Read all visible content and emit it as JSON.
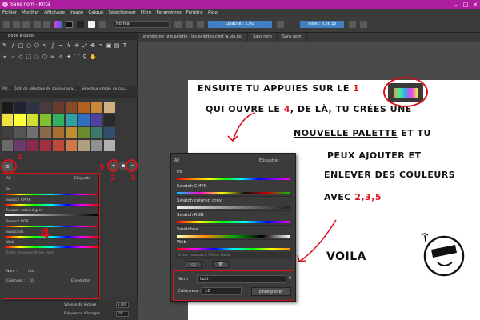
{
  "window": {
    "title": "Sans nom - Krita"
  },
  "menu": [
    "Fichier",
    "Modifier",
    "Affichage",
    "Image",
    "Calque",
    "Sélectionner",
    "Filtre",
    "Paramètres",
    "Fenêtre",
    "Aide"
  ],
  "toolbar": {
    "blend_mode": "Normal",
    "opacity_label": "Opacité : 1,00",
    "size_label": "Taille : 8,36 px"
  },
  "dockers": {
    "toolbox_title": "Boîte à outils",
    "palette_title": "Palette",
    "tabs": [
      "Pal.",
      "Outil de sélection de couleur ava...",
      "Sélecteur simple de cou..."
    ]
  },
  "document_tabs": [
    "enregistrer une palette - les palettes c'est la vie.jpg",
    "Sans nom",
    "Sans nom"
  ],
  "palette_swatches": [
    "#1a1a1a",
    "#202432",
    "#2f3346",
    "#4a3a40",
    "#6a3a30",
    "#8a4a25",
    "#b06020",
    "#c88a3a",
    "#d0b080",
    "#f0e040",
    "#ffff40",
    "#d0e030",
    "#80c030",
    "#30b060",
    "#30a0a0",
    "#3070c0",
    "#5040a0",
    "#2a2a2a",
    "#404040",
    "#555",
    "#707070",
    "#8a6a4a",
    "#a86e30",
    "#c09030",
    "#6a8a30",
    "#3a7a6a",
    "#305070",
    "#6a6a6a",
    "#6a3a6a",
    "#8a2a4a",
    "#a03040",
    "#c04a3a",
    "#d07a4a",
    "#b0a080",
    "#909090",
    "#b0b0b0"
  ],
  "popup_small": {
    "filter_value": "All",
    "tag_label": "Étiquette",
    "items": [
      "Ps",
      "Swatch CMYK",
      "Swatch colored grey",
      "Swatch RGB",
      "Swatches",
      "Web"
    ],
    "search_placeholder": "Enter resource filters here",
    "name_label": "Nom :",
    "name_value": "test",
    "columns_label": "Colonnes :",
    "columns_value": "10",
    "save_label": "Enregistrer"
  },
  "popup_big": {
    "filter_value": "All",
    "tag_label": "Étiquette",
    "items": [
      {
        "name": "Ps"
      },
      {
        "name": "Swatch CMYK"
      },
      {
        "name": "Swatch colored grey"
      },
      {
        "name": "Swatch RGB"
      },
      {
        "name": "Swatches"
      },
      {
        "name": "Web"
      }
    ],
    "search_placeholder": "Enter resource filters here",
    "name_label": "Nom :",
    "name_value": "test",
    "columns_label": "Colonnes :",
    "columns_value": "10",
    "save_label": "Enregistrer"
  },
  "annotation": {
    "line1a": "ENSUITE TU APPUIES SUR LE",
    "line1b": "1",
    "line2a": "QUI OUVRE LE",
    "line2b": "4",
    "line2c": ", DE LÀ, TU CRÉES UNE",
    "line3a": "NOUVELLE PALETTE",
    "line3b": "ET TU",
    "line4": "PEUX AJOUTER ET",
    "line5": "ENLEVER DES COULEURS",
    "line6a": "AVEC",
    "line6b": "2,3,5",
    "voila": "VOILA",
    "num1": "1",
    "num2": "2",
    "num3": "3",
    "num4": "4",
    "num5": "5"
  },
  "bottom": {
    "speed_label": "Vitesse de lecture :",
    "speed_value": "1,00",
    "fps_label": "Fréquence d'images :",
    "fps_value": "24"
  },
  "colors": {
    "accent": "#ad1f9e",
    "annotation_red": "#d8111b",
    "input_blue": "#3f7fc2"
  }
}
